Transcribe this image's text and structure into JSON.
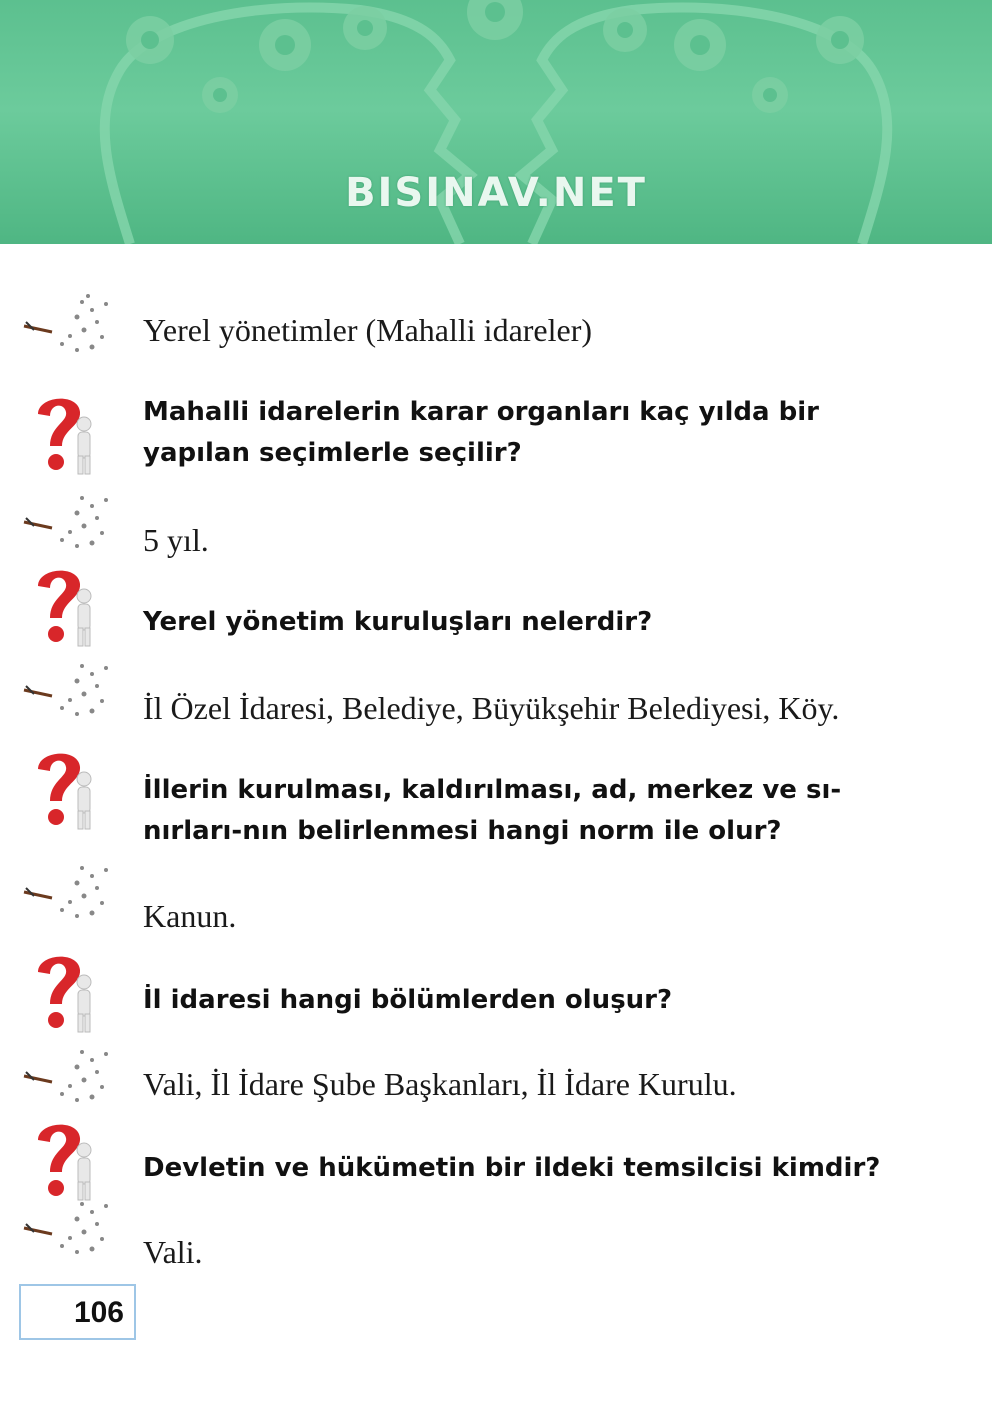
{
  "header": {
    "brand": "BISINAV.NET"
  },
  "items": [
    {
      "kind": "answer",
      "text": "Yerel yönetimler (Mahalli idareler)"
    },
    {
      "kind": "question",
      "text": "Mahalli idarelerin karar organları kaç yılda bir yapılan seçimlerle seçilir?"
    },
    {
      "kind": "answer",
      "text": "5 yıl."
    },
    {
      "kind": "question",
      "text": "Yerel yönetim kuruluşları nelerdir?"
    },
    {
      "kind": "answer",
      "text": "İl Özel İdaresi, Belediye, Büyükşehir Belediyesi, Köy."
    },
    {
      "kind": "question",
      "text": "İllerin kurulması, kaldırılması, ad, merkez ve sı-nırları-nın belirlenmesi hangi norm ile olur?"
    },
    {
      "kind": "answer",
      "text": "Kanun."
    },
    {
      "kind": "question",
      "text": "İl idaresi hangi bölümlerden oluşur?"
    },
    {
      "kind": "answer",
      "text": "Vali, İl İdare Şube Başkanları, İl İdare Kurulu."
    },
    {
      "kind": "question",
      "text": "Devletin ve hükümetin bir ildeki temsilcisi kimdir?"
    },
    {
      "kind": "answer",
      "text": "Vali."
    }
  ],
  "page_number": "106",
  "icons": {
    "answer": "pen-writing-icon",
    "question": "question-mark-figure-icon"
  },
  "colors": {
    "banner": "#5cc08f",
    "question_mark": "#d8262a",
    "page_box_border": "#9ec6e6"
  }
}
